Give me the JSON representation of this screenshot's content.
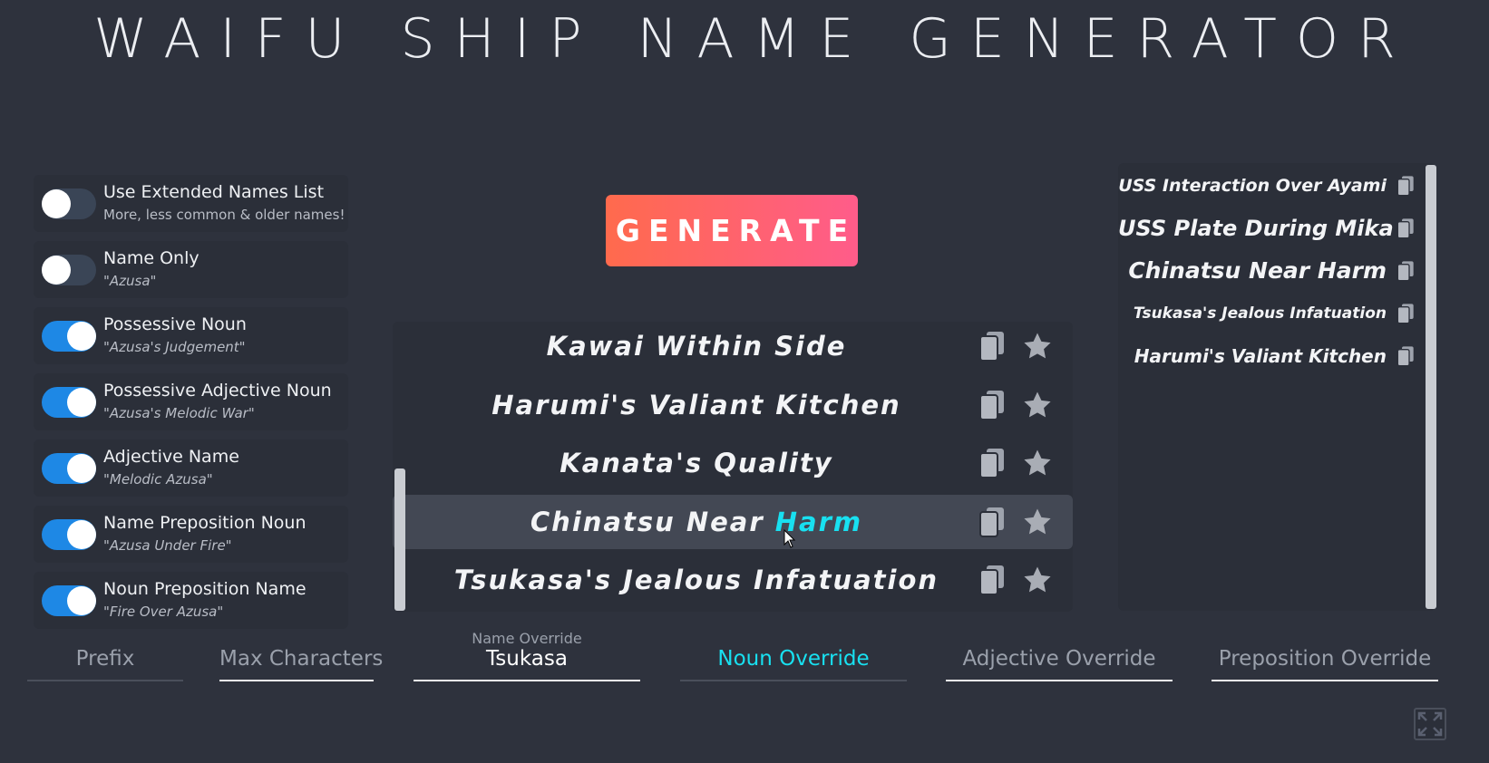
{
  "title": "WAIFU SHIP NAME GENERATOR",
  "generate_label": "GENERATE",
  "toggles": [
    {
      "label": "Use Extended Names List",
      "sub": "More, less common & older names!",
      "on": false,
      "italic": false
    },
    {
      "label": "Name Only",
      "sub": "\"Azusa\"",
      "on": false,
      "italic": true
    },
    {
      "label": "Possessive Noun",
      "sub": "\"Azusa's Judgement\"",
      "on": true,
      "italic": true
    },
    {
      "label": "Possessive Adjective Noun",
      "sub": "\"Azusa's Melodic War\"",
      "on": true,
      "italic": true
    },
    {
      "label": "Adjective Name",
      "sub": "\"Melodic Azusa\"",
      "on": true,
      "italic": true
    },
    {
      "label": "Name Preposition Noun",
      "sub": "\"Azusa Under Fire\"",
      "on": true,
      "italic": true
    },
    {
      "label": "Noun Preposition Name",
      "sub": "\"Fire Over Azusa\"",
      "on": true,
      "italic": true
    }
  ],
  "results": [
    {
      "text": "Kawai Within Side"
    },
    {
      "text": "Harumi's Valiant Kitchen"
    },
    {
      "text": "Kanata's Quality"
    },
    {
      "text_pre": "Chinatsu Near ",
      "text_hl": "Harm",
      "hover": true
    },
    {
      "text": "Tsukasa's Jealous Infatuation"
    }
  ],
  "history": [
    {
      "text": "USS Interaction Over Ayami",
      "size": 19
    },
    {
      "text": "USS Plate During Mika",
      "size": 24
    },
    {
      "text": "Chinatsu Near Harm",
      "size": 25
    },
    {
      "text": "Tsukasa's Jealous Infatuation",
      "size": 17
    },
    {
      "text": "Harumi's Valiant Kitchen",
      "size": 20
    }
  ],
  "fields": {
    "prefix": "Prefix",
    "max_chars": "Max Characters",
    "name_override_label": "Name Override",
    "name_override_value": "Tsukasa",
    "noun_override": "Noun Override",
    "adjective_override": "Adjective Override",
    "preposition_override": "Preposition Override"
  },
  "colors": {
    "accent_blue": "#1e88e5",
    "highlight_cyan": "#18e0f0",
    "generate_gradient_start": "#ff6a4d",
    "generate_gradient_end": "#ff5c8a",
    "background": "#2e323d"
  },
  "icons": {
    "copy": "copy-icon",
    "favorite": "star-icon",
    "fullscreen": "expand-icon"
  }
}
